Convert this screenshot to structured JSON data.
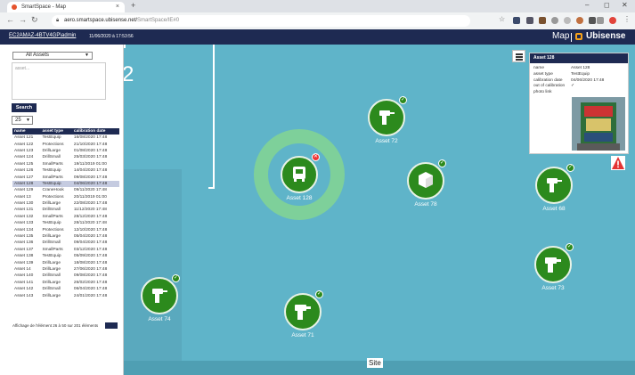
{
  "browser": {
    "tab_title": "SmartSpace - Map",
    "tab_close": "×",
    "new_tab": "+",
    "url_host": "aero.smartspace.ubisense.net/",
    "url_path": "SmartSpace/IE#0",
    "win_min": "–",
    "win_max": "◻",
    "win_close": "✕"
  },
  "header": {
    "user": "EC2AMAZ-4BTV4GP\\admin",
    "datetime": "11/06/2020 à 17:53:56",
    "page_title": "Map",
    "brand": "Ubisense"
  },
  "sidebar": {
    "filter_selected": "All Assets",
    "search_placeholder": "asset...",
    "search_button": "Search",
    "page_size": "25",
    "columns": [
      "name",
      "asset type",
      "calibration date"
    ],
    "rows": [
      [
        "Asset 121",
        "TestEquip",
        "16/08/2020 17:48"
      ],
      [
        "Asset 122",
        "Protections",
        "21/10/2020 17:48"
      ],
      [
        "Asset 123",
        "DrillLarge",
        "01/08/2020 17:48"
      ],
      [
        "Asset 124",
        "DrillSmall",
        "25/03/2020 17:48"
      ],
      [
        "Asset 125",
        "SmallParts",
        "19/11/2019 01:00"
      ],
      [
        "Asset 126",
        "TestEquip",
        "14/04/2020 17:48"
      ],
      [
        "Asset 127",
        "SmallParts",
        "09/08/2020 17:48"
      ],
      [
        "Asset 128",
        "TestEquip",
        "04/06/2020 17:48"
      ],
      [
        "Asset 129",
        "CraneHook",
        "09/11/2020 17:48"
      ],
      [
        "Asset 13",
        "Protections",
        "20/11/2019 01:00"
      ],
      [
        "Asset 130",
        "DrillLarge",
        "22/08/2020 17:48"
      ],
      [
        "Asset 131",
        "DrillSmall",
        "11/12/2020 17:48"
      ],
      [
        "Asset 132",
        "SmallParts",
        "28/12/2020 17:48"
      ],
      [
        "Asset 133",
        "TestEquip",
        "28/11/2020 17:48"
      ],
      [
        "Asset 134",
        "Protections",
        "12/10/2020 17:48"
      ],
      [
        "Asset 135",
        "DrillLarge",
        "05/04/2020 17:48"
      ],
      [
        "Asset 136",
        "DrillSmall",
        "09/04/2020 17:48"
      ],
      [
        "Asset 137",
        "SmallParts",
        "03/12/2020 17:48"
      ],
      [
        "Asset 138",
        "TestEquip",
        "05/09/2020 17:48"
      ],
      [
        "Asset 139",
        "DrillLarge",
        "18/08/2020 17:48"
      ],
      [
        "Asset 14",
        "DrillLarge",
        "27/06/2020 17:48"
      ],
      [
        "Asset 140",
        "DrillSmall",
        "09/08/2020 17:48"
      ],
      [
        "Asset 141",
        "DrillLarge",
        "26/02/2020 17:48"
      ],
      [
        "Asset 142",
        "DrillSmall",
        "06/04/2020 17:48"
      ],
      [
        "Asset 143",
        "DrillLarge",
        "24/01/2020 17:48"
      ]
    ],
    "selected_row": 7,
    "pager_text": "Affichage de l'élément 26 à 50 sur 201 éléments"
  },
  "map": {
    "room_number": "2",
    "site_label": "Site",
    "markers": [
      {
        "label": "Asset 72",
        "icon": "drill-icon",
        "status": "ok"
      },
      {
        "label": "Asset 128",
        "icon": "test-equipment-icon",
        "status": "error"
      },
      {
        "label": "Asset 78",
        "icon": "small-parts-box-icon",
        "status": "ok"
      },
      {
        "label": "Asset 68",
        "icon": "drill-icon",
        "status": "ok"
      },
      {
        "label": "Asset 73",
        "icon": "drill-large-icon",
        "status": "ok"
      },
      {
        "label": "Asset 74",
        "icon": "drill-icon",
        "status": "ok"
      },
      {
        "label": "Asset 71",
        "icon": "drill-large-icon",
        "status": "ok"
      }
    ],
    "check_glyph": "✓",
    "error_glyph": "✕"
  },
  "popup": {
    "title": "Asset 128",
    "fields": [
      {
        "key": "name",
        "value": "Asset 128"
      },
      {
        "key": "asset type",
        "value": "TestEquip"
      },
      {
        "key": "calibration date",
        "value": "04/06/2020 17:48"
      },
      {
        "key": "out of calibration",
        "value": "✓"
      },
      {
        "key": "photo link",
        "value": ""
      }
    ]
  },
  "colors": {
    "header_navy": "#1e2a52",
    "map_water": "#5fb4c9",
    "marker_green": "#2c8a1d",
    "ring_green": "#7ed09a",
    "brand_orange": "#f7a21b",
    "alert_red": "#e33333"
  }
}
